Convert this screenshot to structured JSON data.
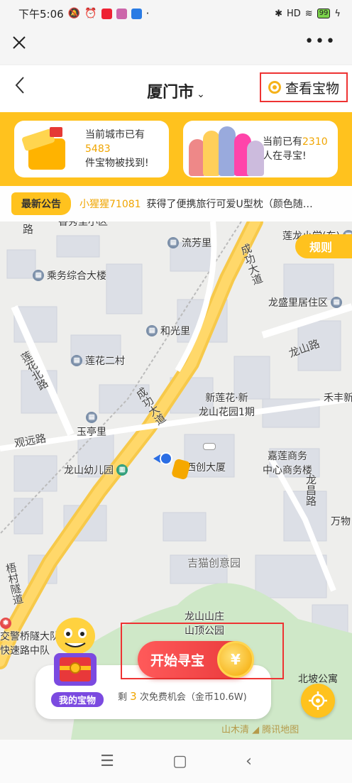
{
  "status": {
    "time": "下午5:06",
    "battery": "99",
    "signal_label": "HD"
  },
  "app_bar": {
    "close_icon": "close-icon",
    "more_label": "•••"
  },
  "nav": {
    "back_label": "‹",
    "city": "厦门市",
    "city_caret": "⌄",
    "treasure_button": "查看宝物"
  },
  "banner": {
    "card1_line1": "当前城市已有",
    "card1_count": "5483",
    "card1_line2": "件宝物被找到!",
    "card2_prefix": "当前已有",
    "card2_count": "2310",
    "card2_line2": "人在寻宝!"
  },
  "notice": {
    "tag": "最新公告",
    "user": "小猩猩71081",
    "message": "获得了便携旅行可爱U型枕（颜色随…"
  },
  "map": {
    "pois": {
      "liufangli": "流芳里",
      "chengwu": "乘务综合大楼",
      "lianlong_school": "莲龙小学(东)",
      "longshengli": "龙盛里居住区",
      "heguangli": "和光里",
      "lianhua2": "莲花二村",
      "xinlianhua": "新莲花·新",
      "longshan_garden": "龙山花园1期",
      "hefeng": "禾丰新",
      "yutingli": "玉亭里",
      "longshan_kinder": "龙山幼儿园",
      "haichuang": "海西创大厦",
      "jiasha": "嘉莲商务",
      "jiasha2": "中心商务楼",
      "wanwu": "万物",
      "jimao": "吉猫创意园",
      "longshan_villa": "龙山山庄",
      "longshan_park": "山顶公园",
      "traffic_police": "交警桥隧大队",
      "expressway": "快速路中队",
      "xiufang": "香秀里小区",
      "north_poi": "北坡公寓"
    },
    "roads": {
      "chenggong1": "成功大道",
      "chenggong2": "成功大道",
      "longshan_rd": "龙山路",
      "lianhua_rd": "莲花北路",
      "guanyuan": "观远路",
      "longchang": "龙昌路",
      "wucun": "梧村隧道",
      "road_lu": "路"
    }
  },
  "rules_button": "规则",
  "start": {
    "label": "开始寻宝",
    "coin_symbol": "¥"
  },
  "chances": {
    "prefix": "剩",
    "count": "3",
    "suffix": "次免费机会（金币10.6W)"
  },
  "mascot_label": "我的宝物",
  "watermark": "山木清 ◢ 腾讯地图",
  "system_nav": {
    "menu": "☰",
    "home": "▢",
    "back": "‹"
  },
  "colors": {
    "accent": "#ffc21e",
    "start": "#e8383a",
    "highlight": "#f0a500"
  }
}
